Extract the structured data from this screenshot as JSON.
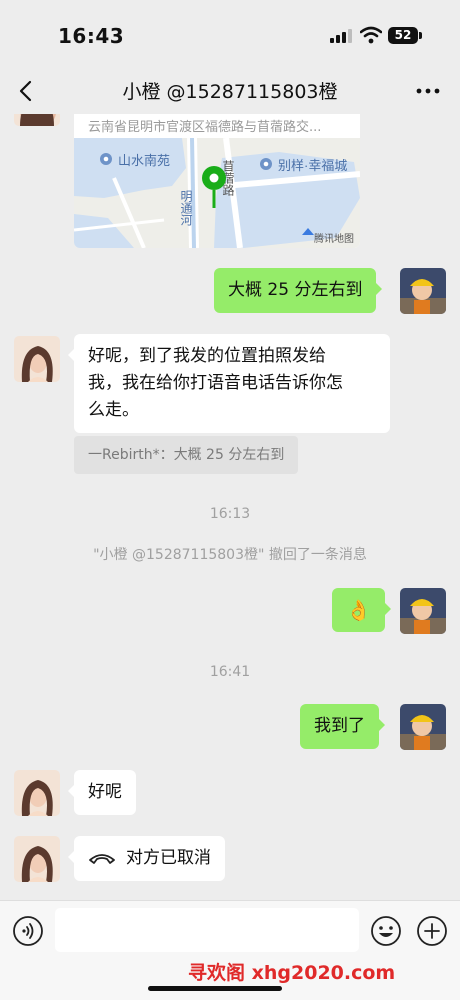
{
  "status_bar": {
    "time": "16:43",
    "battery": "52"
  },
  "nav": {
    "title": "小橙 @15287115803橙"
  },
  "map": {
    "address": "云南省昆明市官渡区福德路与苜蓿路交...",
    "labels": {
      "poi1": "山水南苑",
      "poi2": "别样·幸福城",
      "road1": "苜蓿路",
      "river": "明通河",
      "watermark": "腾讯地图"
    }
  },
  "messages": {
    "m1": "大概 25 分左右到",
    "m2": "好呢，到了我发的位置拍照发给我，我在给你打语音电话告诉你怎么走。",
    "m2_line1": "好呢，到了我发的位置拍照发给",
    "m2_line2": "我，我在给你打语音电话告诉你怎",
    "m2_line3": "么走。",
    "quote": "一Rebirth*：大概 25 分左右到",
    "time1": "16:13",
    "recall_notice": "\"小橙 @15287115803橙\" 撤回了一条消息",
    "m3_emoji": "👌",
    "time2": "16:41",
    "m4": "我到了",
    "m5": "好呢",
    "m6": "对方已取消"
  },
  "watermark": "寻欢阁 xhg2020.com",
  "colors": {
    "sent_bubble": "#95ec69",
    "received_bubble": "#ffffff",
    "background": "#ededed",
    "map_pin": "#1aad19"
  }
}
